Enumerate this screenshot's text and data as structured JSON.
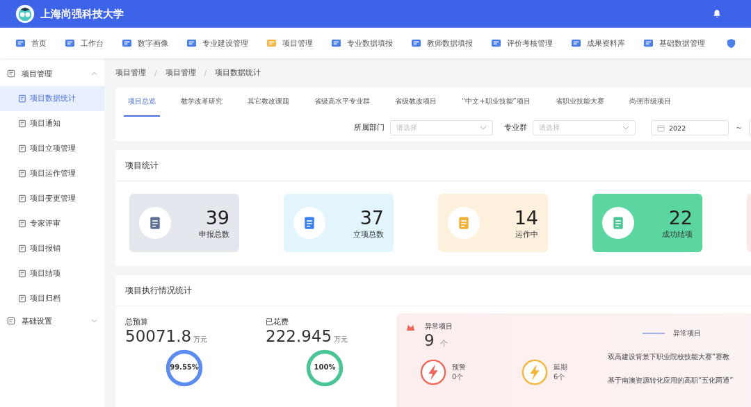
{
  "header": {
    "title": "上海尚强科技大学"
  },
  "nav": [
    {
      "label": "首页",
      "selected": false
    },
    {
      "label": "工作台",
      "selected": false
    },
    {
      "label": "数字画像",
      "selected": false
    },
    {
      "label": "专业建设管理",
      "selected": false
    },
    {
      "label": "项目管理",
      "selected": true
    },
    {
      "label": "专业数据填报",
      "selected": false
    },
    {
      "label": "教师数据填报",
      "selected": false
    },
    {
      "label": "评价考核管理",
      "selected": false
    },
    {
      "label": "成果资料库",
      "selected": false
    },
    {
      "label": "基础数据管理",
      "selected": false
    }
  ],
  "sidebar": {
    "items": [
      {
        "label": "项目管理",
        "expanded": true,
        "children": [
          {
            "label": "项目数据统计",
            "selected": true
          },
          {
            "label": "项目通知",
            "selected": false
          },
          {
            "label": "项目立项管理",
            "selected": false
          },
          {
            "label": "项目运作管理",
            "selected": false
          },
          {
            "label": "项目变更管理",
            "selected": false
          },
          {
            "label": "专家评审",
            "selected": false
          },
          {
            "label": "项目报销",
            "selected": false
          },
          {
            "label": "项目结项",
            "selected": false
          },
          {
            "label": "项目归档",
            "selected": false
          }
        ]
      },
      {
        "label": "基础设置",
        "expanded": false
      }
    ]
  },
  "breadcrumb": {
    "separator": "/",
    "items": [
      "项目管理",
      "项目管理",
      "项目数据统计"
    ]
  },
  "tabs": [
    {
      "label": "项目总览",
      "selected": true
    },
    {
      "label": "教学改革研究",
      "selected": false
    },
    {
      "label": "其它教改课题",
      "selected": false
    },
    {
      "label": "省级高水平专业群",
      "selected": false
    },
    {
      "label": "省级教改项目",
      "selected": false
    },
    {
      "label": "“中文+职业技能”项目",
      "selected": false
    },
    {
      "label": "省职业技能大赛",
      "selected": false
    },
    {
      "label": "尚强市级项目",
      "selected": false
    }
  ],
  "filters": {
    "department": {
      "label": "所属部门",
      "placeholder": "请选择"
    },
    "group": {
      "label": "专业群",
      "placeholder": "请选择"
    },
    "date_from": "2022",
    "separator": "~"
  },
  "stats": {
    "title": "项目统计",
    "cards": [
      {
        "value": "39",
        "label": "申报总数",
        "color": "#e4e7ee"
      },
      {
        "value": "37",
        "label": "立项总数",
        "color": "#e2f4fc"
      },
      {
        "value": "14",
        "label": "运作中",
        "color": "#fdf0dc"
      },
      {
        "value": "22",
        "label": "成功结项",
        "color": "#5cd6a1"
      }
    ]
  },
  "execution": {
    "title": "项目执行情况统计",
    "budgets": [
      {
        "label": "总预算",
        "value": "50071.8",
        "unit": "万元",
        "level": 0.9955,
        "percent": "99.55%",
        "color": "#5b8cf0"
      },
      {
        "label": "已花费",
        "value": "222.945",
        "unit": "万元",
        "level": 1,
        "percent": "100%",
        "color": "#4cc596"
      }
    ],
    "anomaly": {
      "title": "异常项目",
      "count": "9",
      "unit": "个",
      "items": [
        {
          "label": "预警",
          "count": "0个",
          "color": "#f0675a"
        },
        {
          "label": "延期",
          "count": "6个",
          "color": "#f4b53a"
        }
      ],
      "legend": "异常项目",
      "list": [
        "双高建设背景下职业院校技能大赛“赛教",
        "基于南澳资源转化应用的高职“五化两通”"
      ]
    }
  }
}
